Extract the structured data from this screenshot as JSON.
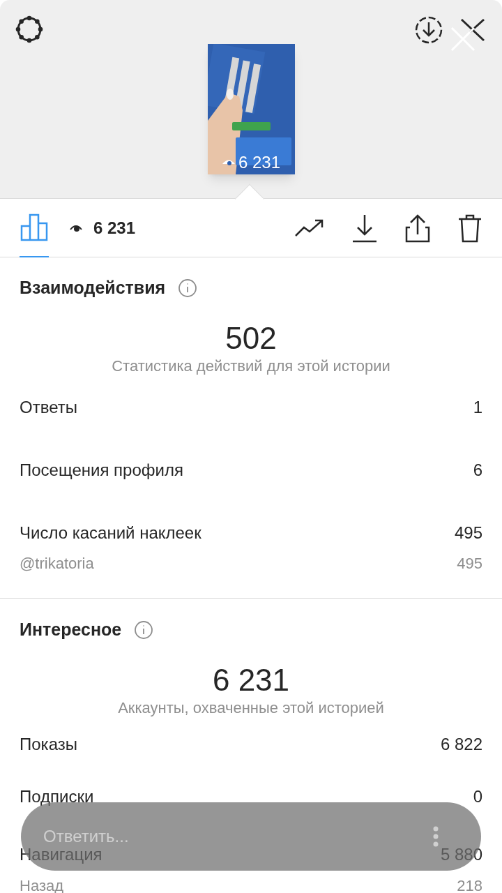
{
  "preview": {
    "kind": "picture",
    "views": "6 231"
  },
  "toolbar": {
    "views": "6 231",
    "tabs": [
      {
        "selected": true
      }
    ]
  },
  "sections": [
    {
      "title": "Взаимодействия",
      "total": "502",
      "caption": "Статистика действий для этой истории",
      "rows": [
        {
          "kind": "main",
          "label": "Ответы",
          "value": "1"
        },
        {
          "kind": "main",
          "label": "Посещения профиля",
          "value": "6"
        },
        {
          "kind": "main",
          "label": "Число касаний наклеек",
          "value": "495"
        },
        {
          "kind": "sub",
          "label": "@trikatoria",
          "value": "495"
        }
      ]
    },
    {
      "title": "Интересное",
      "total": "6 231",
      "caption": "Аккаунты, охваченные этой историей",
      "rows": [
        {
          "kind": "main",
          "label": "Показы",
          "value": "6 822"
        },
        {
          "kind": "main",
          "label": "Подписки",
          "value": "0"
        },
        {
          "kind": "main",
          "label": "Навигация",
          "value": "5 880"
        },
        {
          "kind": "sub",
          "label": "Назад",
          "value": "218"
        }
      ]
    }
  ],
  "reply": {
    "placeholder": "Ответить..."
  }
}
